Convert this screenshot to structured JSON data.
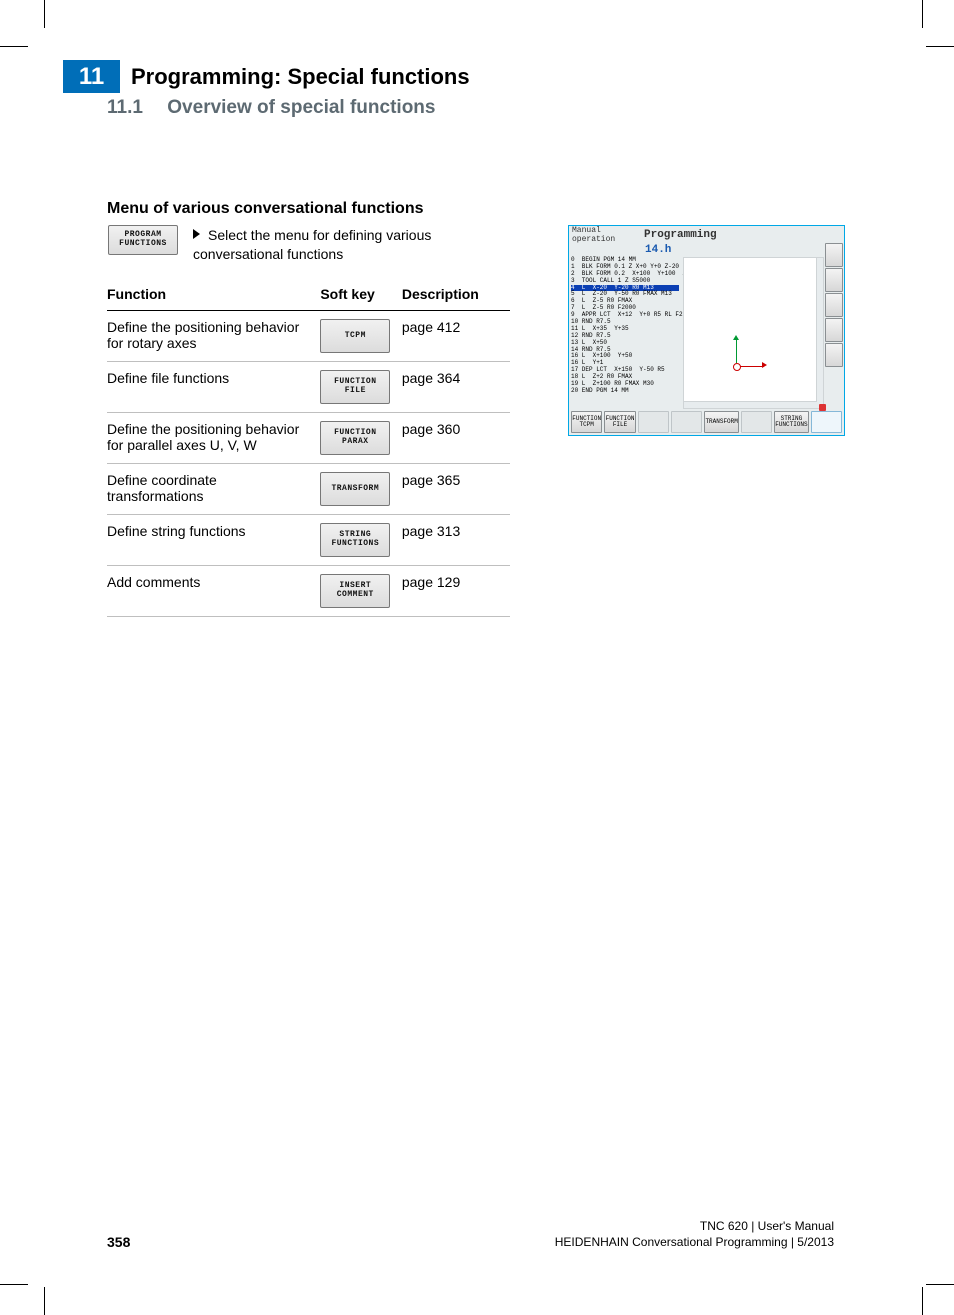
{
  "chapter": {
    "number": "11",
    "title": "Programming: Special functions"
  },
  "section": {
    "number": "11.1",
    "title": "Overview of special functions"
  },
  "subhead": "Menu of various conversational functions",
  "intro_key": {
    "line1": "PROGRAM",
    "line2": "FUNCTIONS"
  },
  "intro_text": "Select the menu for defining various conversational functions",
  "table": {
    "headers": {
      "function": "Function",
      "softkey": "Soft key",
      "description": "Description"
    },
    "rows": [
      {
        "func": "Define the positioning behavior for rotary axes",
        "key_l1": "TCPM",
        "key_l2": "",
        "desc": "page 412"
      },
      {
        "func": "Define file functions",
        "key_l1": "FUNCTION",
        "key_l2": "FILE",
        "desc": "page 364"
      },
      {
        "func": "Define the positioning behavior for parallel axes U, V, W",
        "key_l1": "FUNCTION",
        "key_l2": "PARAX",
        "desc": "page 360"
      },
      {
        "func": "Define coordinate transformations",
        "key_l1": "TRANSFORM",
        "key_l2": "",
        "desc": "page 365"
      },
      {
        "func": "Define string functions",
        "key_l1": "STRING",
        "key_l2": "FUNCTIONS",
        "desc": "page 313"
      },
      {
        "func": "Add comments",
        "key_l1": "INSERT",
        "key_l2": "COMMENT",
        "desc": "page 129"
      }
    ]
  },
  "screenshot": {
    "mode": "Manual operation",
    "program": "Programming",
    "filename": "14.h",
    "code": "0  BEGIN PGM 14 MM\n1  BLK FORM 0.1 Z X+0 Y+0 Z-20\n2  BLK FORM 0.2  X+100  Y+100  Z+0\n3  TOOL CALL 1 Z S5000\n",
    "code_hl": "4  L  X-20  Y-20 R0 M13",
    "code_after": "5  L  Z-20  Y-50 R0 FMAX M13\n6  L  Z-5 R0 FMAX\n7  L  Z-5 R0 F2000\n9  APPR LCT  X+12  Y+0 R5 RL F250\n10 RND R7.5\n11 L  X+35  Y+35\n12 RND R7.5\n13 L  X+50\n14 RND R7.5\n16 L  X+100  Y+50\n16 L  Y+1\n17 DEP LCT  X+150  Y-50 R5\n18 L  Z+2 R0 FMAX\n19 L  Z+100 R0 FMAX M30\n20 END PGM 14 MM",
    "bottom_buttons": [
      "FUNCTION\nTCPM",
      "FUNCTION\nFILE",
      "",
      "",
      "TRANSFORM",
      "",
      "STRING\nFUNCTIONS",
      ""
    ]
  },
  "footer": {
    "pagenum": "358",
    "line1": "TNC 620 | User's Manual",
    "line2": "HEIDENHAIN Conversational Programming | 5/2013"
  }
}
